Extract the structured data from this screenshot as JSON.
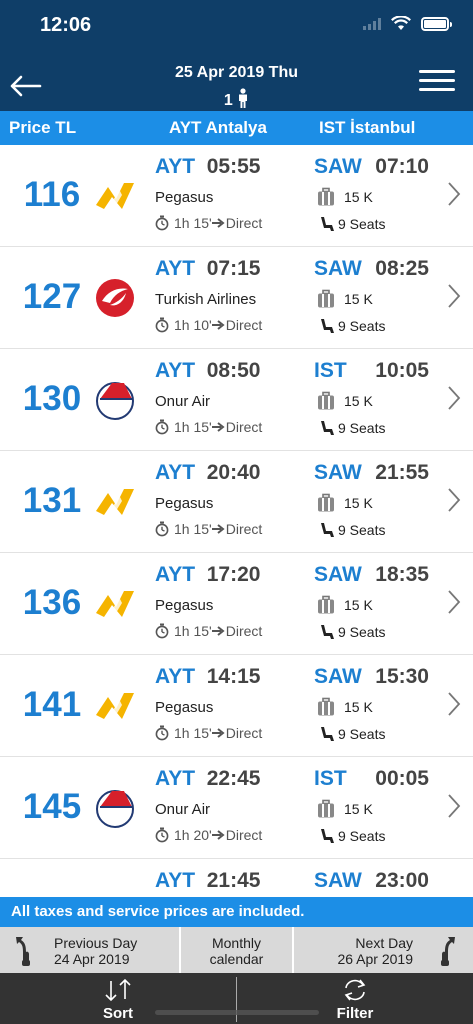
{
  "status": {
    "time": "12:06"
  },
  "header": {
    "date": "25 Apr 2019 Thu",
    "passengers": "1"
  },
  "columns": {
    "price": "Price TL",
    "origin": "AYT Antalya",
    "destination": "IST İstanbul"
  },
  "flights": [
    {
      "price": "116",
      "dep_code": "AYT",
      "dep_time": "05:55",
      "arr_code": "SAW",
      "arr_time": "07:10",
      "airline": "Pegasus",
      "logo": "pegasus-logo-icon",
      "duration": "1h 15'",
      "type": "Direct",
      "baggage": "15 K",
      "seats": "9 Seats"
    },
    {
      "price": "127",
      "dep_code": "AYT",
      "dep_time": "07:15",
      "arr_code": "SAW",
      "arr_time": "08:25",
      "airline": "Turkish Airlines",
      "logo": "turkish-airlines-logo-icon",
      "duration": "1h 10'",
      "type": "Direct",
      "baggage": "15 K",
      "seats": "9 Seats"
    },
    {
      "price": "130",
      "dep_code": "AYT",
      "dep_time": "08:50",
      "arr_code": "IST",
      "arr_time": "10:05",
      "airline": "Onur Air",
      "logo": "onur-air-logo-icon",
      "duration": "1h 15'",
      "type": "Direct",
      "baggage": "15 K",
      "seats": "9 Seats"
    },
    {
      "price": "131",
      "dep_code": "AYT",
      "dep_time": "20:40",
      "arr_code": "SAW",
      "arr_time": "21:55",
      "airline": "Pegasus",
      "logo": "pegasus-logo-icon",
      "duration": "1h 15'",
      "type": "Direct",
      "baggage": "15 K",
      "seats": "9 Seats"
    },
    {
      "price": "136",
      "dep_code": "AYT",
      "dep_time": "17:20",
      "arr_code": "SAW",
      "arr_time": "18:35",
      "airline": "Pegasus",
      "logo": "pegasus-logo-icon",
      "duration": "1h 15'",
      "type": "Direct",
      "baggage": "15 K",
      "seats": "9 Seats"
    },
    {
      "price": "141",
      "dep_code": "AYT",
      "dep_time": "14:15",
      "arr_code": "SAW",
      "arr_time": "15:30",
      "airline": "Pegasus",
      "logo": "pegasus-logo-icon",
      "duration": "1h 15'",
      "type": "Direct",
      "baggage": "15 K",
      "seats": "9 Seats"
    },
    {
      "price": "145",
      "dep_code": "AYT",
      "dep_time": "22:45",
      "arr_code": "IST",
      "arr_time": "00:05",
      "airline": "Onur Air",
      "logo": "onur-air-logo-icon",
      "duration": "1h 20'",
      "type": "Direct",
      "baggage": "15 K",
      "seats": "9 Seats"
    },
    {
      "price": "",
      "dep_code": "AYT",
      "dep_time": "21:45",
      "arr_code": "SAW",
      "arr_time": "23:00",
      "airline": "",
      "logo": "",
      "duration": "",
      "type": "",
      "baggage": "",
      "seats": ""
    }
  ],
  "notice": "All taxes and service prices are included.",
  "daybar": {
    "prev_label": "Previous Day",
    "prev_date": "24 Apr 2019",
    "monthly_line1": "Monthly",
    "monthly_line2": "calendar",
    "next_label": "Next Day",
    "next_date": "26 Apr 2019"
  },
  "tabs": {
    "sort": "Sort",
    "filter": "Filter"
  },
  "colors": {
    "header": "#0f3e68",
    "accent": "#1c8ee6",
    "price": "#1d7fd0",
    "pegasus": "#f5b400",
    "turkish": "#d6202b",
    "onur": "#d6202b"
  }
}
